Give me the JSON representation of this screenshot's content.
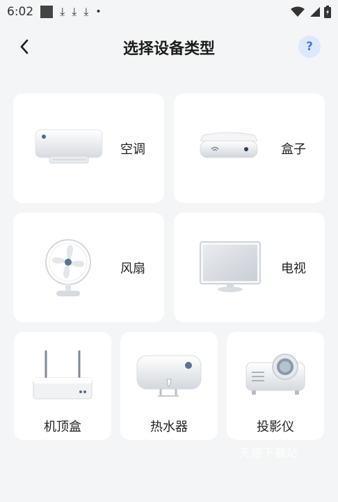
{
  "status_bar": {
    "time": "6:02",
    "download_glyph": "⤓",
    "dot": "•"
  },
  "header": {
    "title": "选择设备类型",
    "help_label": "?"
  },
  "devices": [
    {
      "id": "ac",
      "label": "空调"
    },
    {
      "id": "box",
      "label": "盒子"
    },
    {
      "id": "fan",
      "label": "风扇"
    },
    {
      "id": "tv",
      "label": "电视"
    },
    {
      "id": "router",
      "label": "机顶盒"
    },
    {
      "id": "heater",
      "label": "热水器"
    },
    {
      "id": "projector",
      "label": "投影仪"
    }
  ],
  "watermark": "天德下载站",
  "colors": {
    "background": "#f4f5f6",
    "card": "#ffffff",
    "accent": "#3d7df0",
    "help_bg": "#dde8fb"
  }
}
